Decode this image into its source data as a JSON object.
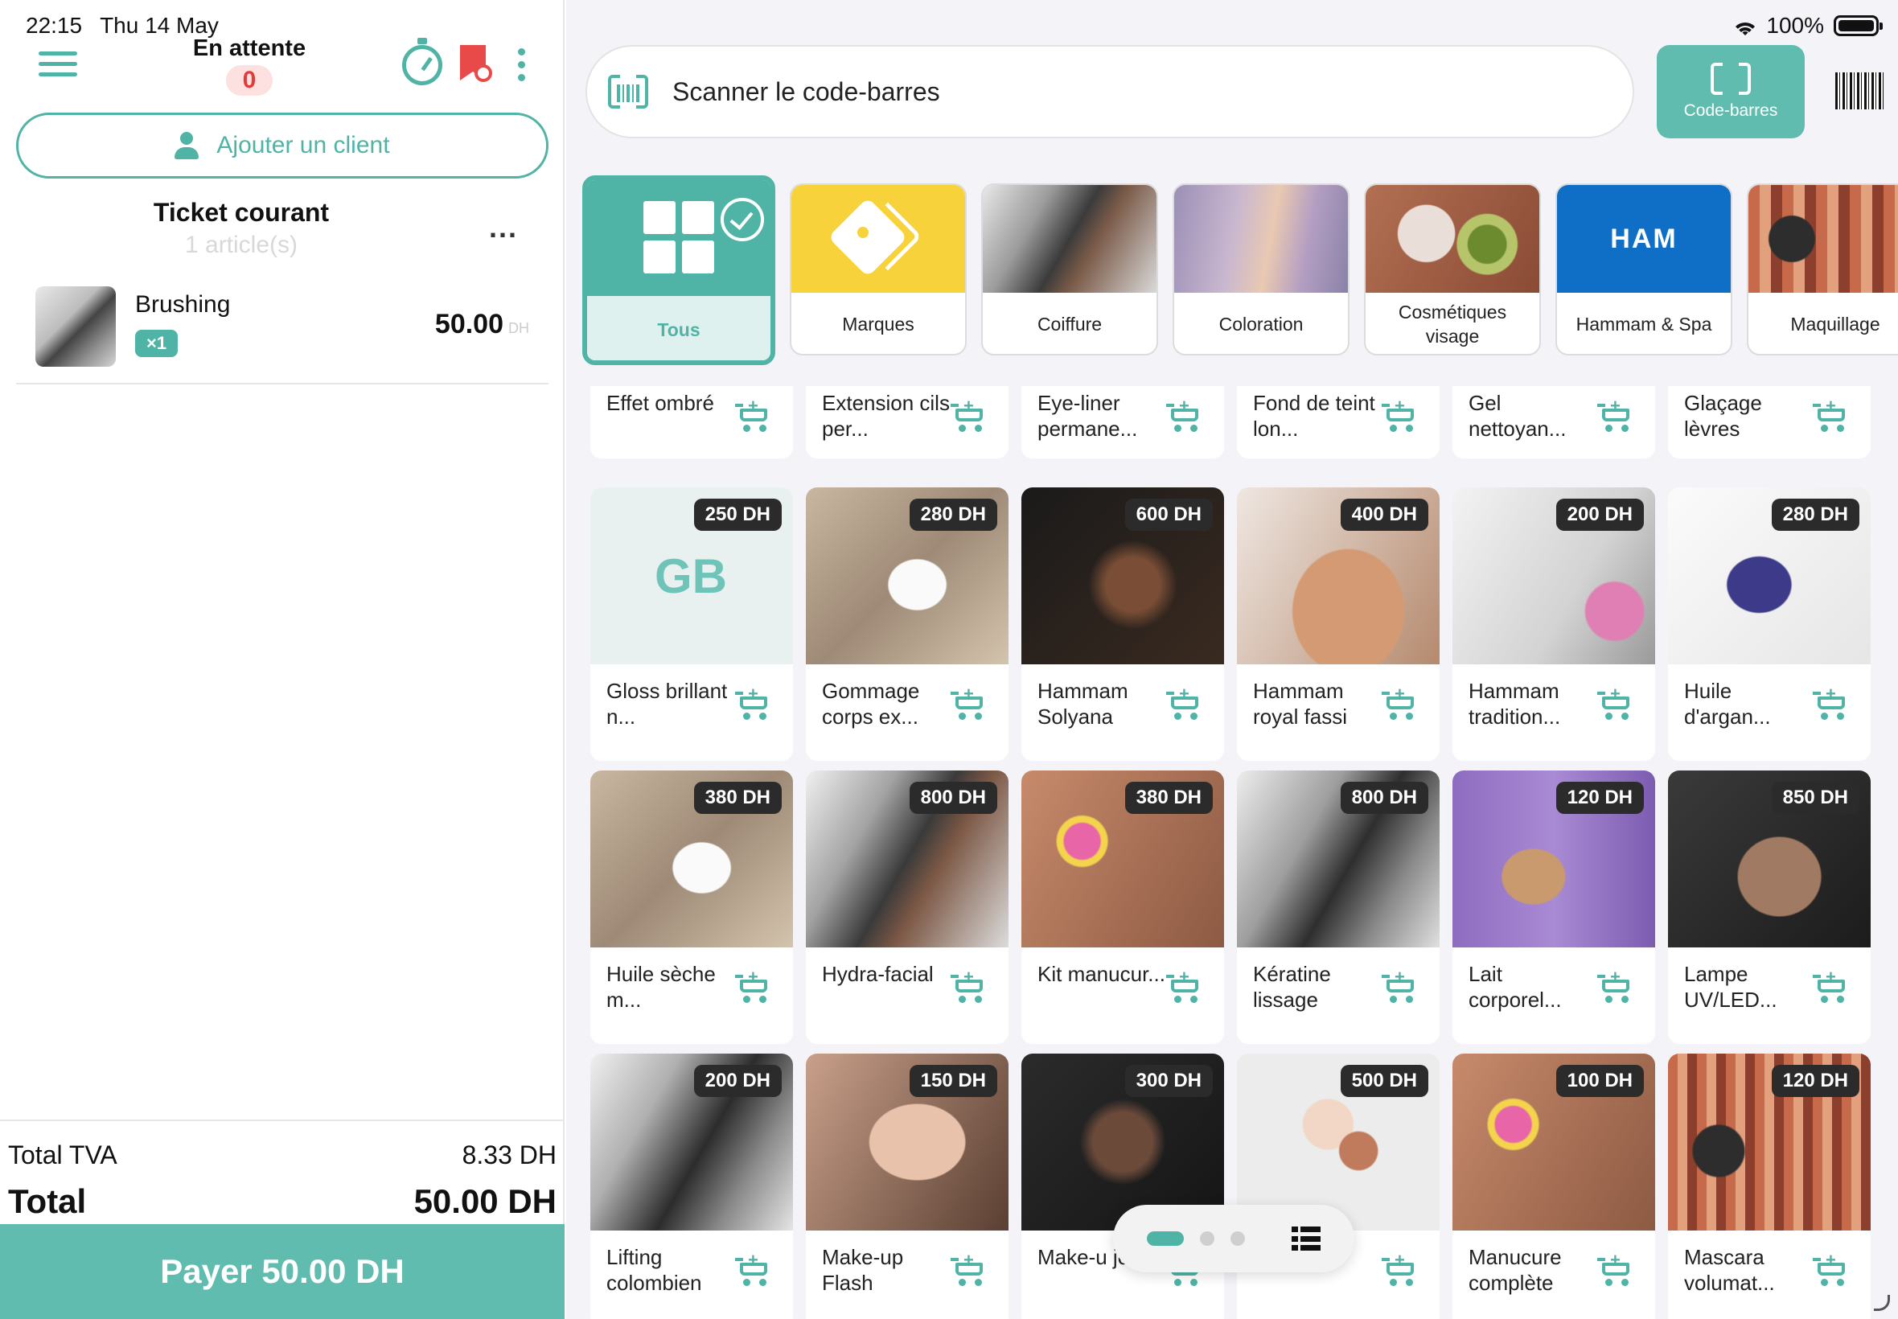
{
  "status_bar": {
    "time": "22:15",
    "date": "Thu 14 May",
    "battery": "100%"
  },
  "header": {
    "pending_label": "En attente",
    "pending_count": "0"
  },
  "client": {
    "add_label": "Ajouter un client"
  },
  "ticket": {
    "title": "Ticket courant",
    "count_label": "1 article(s)",
    "more": "...",
    "items": [
      {
        "name": "Brushing",
        "qty": "×1",
        "price": "50.00",
        "currency": "DH"
      }
    ]
  },
  "totals": {
    "tva_label": "Total TVA",
    "tva_value": "8.33 DH",
    "total_label": "Total",
    "total_value": "50.00 DH",
    "pay_label": "Payer 50.00 DH"
  },
  "search": {
    "placeholder": "Scanner le code-barres"
  },
  "barcode_button": {
    "label": "Code-barres"
  },
  "categories": [
    {
      "label": "Tous",
      "active": true
    },
    {
      "label": "Marques"
    },
    {
      "label": "Coiffure"
    },
    {
      "label": "Coloration"
    },
    {
      "label": "Cosmétiques visage"
    },
    {
      "label": "Hammam & Spa",
      "badge": "HAM"
    },
    {
      "label": "Maquillage"
    }
  ],
  "products_partial": [
    {
      "name": "Effet ombré"
    },
    {
      "name": "Extension cils per..."
    },
    {
      "name": "Eye-liner permane..."
    },
    {
      "name": "Fond de teint lon..."
    },
    {
      "name": "Gel nettoyan..."
    },
    {
      "name": "Glaçage lèvres"
    }
  ],
  "products": [
    {
      "name": "Gloss brillant n...",
      "price": "250 DH",
      "initials": "GB"
    },
    {
      "name": "Gommage corps ex...",
      "price": "280 DH"
    },
    {
      "name": "Hammam Solyana",
      "price": "600 DH"
    },
    {
      "name": "Hammam royal fassi",
      "price": "400 DH"
    },
    {
      "name": "Hammam tradition...",
      "price": "200 DH"
    },
    {
      "name": "Huile d'argan...",
      "price": "280 DH"
    },
    {
      "name": "Huile sèche m...",
      "price": "380 DH"
    },
    {
      "name": "Hydra-facial",
      "price": "800 DH"
    },
    {
      "name": "Kit manucur...",
      "price": "380 DH"
    },
    {
      "name": "Kératine lissage",
      "price": "800 DH"
    },
    {
      "name": "Lait corporel...",
      "price": "120 DH"
    },
    {
      "name": "Lampe UV/LED...",
      "price": "850 DH"
    },
    {
      "name": "Lifting colombien",
      "price": "200 DH"
    },
    {
      "name": "Make-up Flash",
      "price": "150 DH"
    },
    {
      "name": "Make-u jour",
      "price": "300 DH"
    },
    {
      "name": "",
      "price": "500 DH"
    },
    {
      "name": "Manucure complète",
      "price": "100 DH"
    },
    {
      "name": "Mascara volumat...",
      "price": "120 DH"
    }
  ],
  "colors": {
    "accent": "#4fb3a5",
    "pay": "#5fbcae",
    "danger": "#e84a4a",
    "marques": "#f7d23a",
    "hammam": "#0f6fc6"
  }
}
